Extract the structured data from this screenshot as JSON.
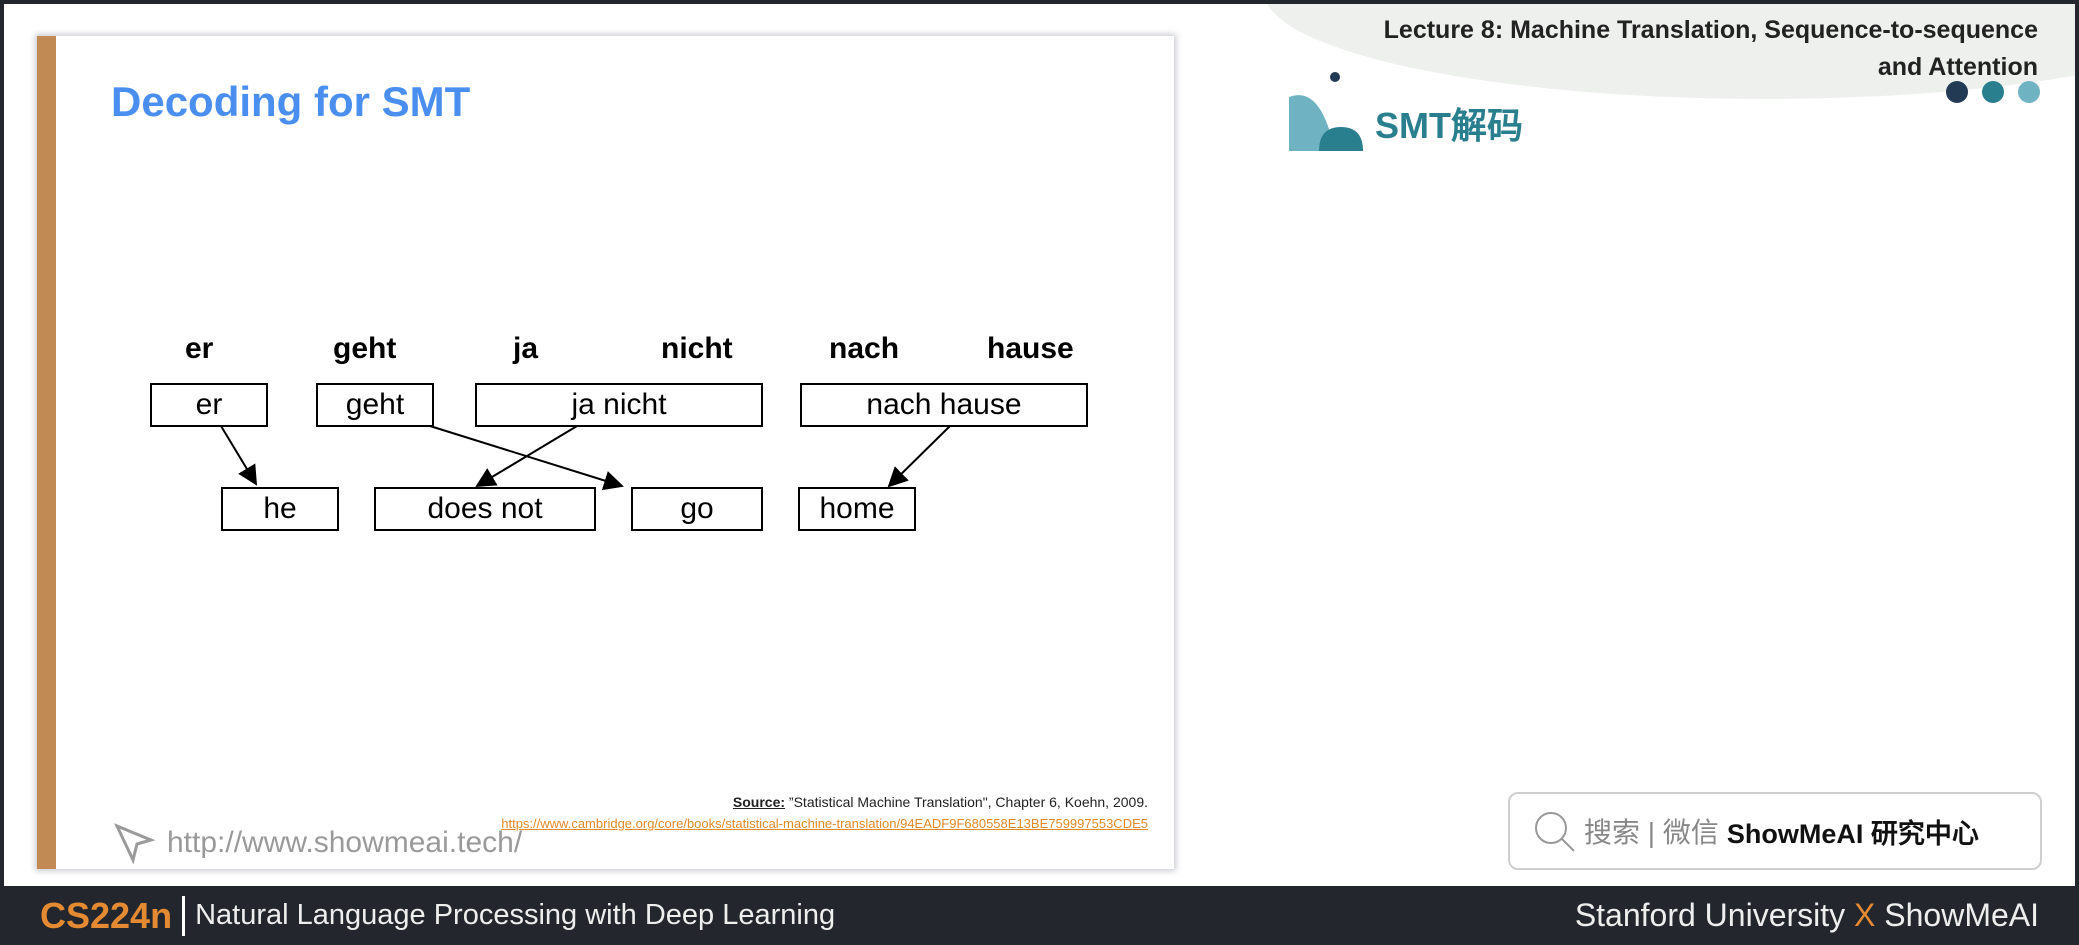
{
  "header": {
    "lecture_line1": "Lecture 8:  Machine Translation, Sequence-to-sequence",
    "lecture_line2": "and Attention",
    "section_title": "SMT解码"
  },
  "slide": {
    "title": "Decoding for SMT",
    "source_words": [
      "er",
      "geht",
      "ja",
      "nicht",
      "nach",
      "hause"
    ],
    "phrases": [
      "er",
      "geht",
      "ja nicht",
      "nach hause"
    ],
    "translations": [
      "he",
      "does not",
      "go",
      "home"
    ],
    "source_label": "Source:",
    "source_text": " ”Statistical Machine Translation\", Chapter 6, Koehn, 2009.",
    "source_link": "https://www.cambridge.org/core/books/statistical-machine-translation/94EADF9F680558E13BE759997553CDE5",
    "watermark": "http://www.showmeai.tech/"
  },
  "search": {
    "text": "搜索 | 微信",
    "brand": "ShowMeAI 研究中心"
  },
  "footer": {
    "course_code": "CS224n",
    "course_name": "Natural Language Processing with Deep Learning",
    "university": "Stanford University",
    "x": "X",
    "partner": "ShowMeAI"
  },
  "colors": {
    "accent_orange": "#e48a32",
    "title_blue": "#4a8ff0",
    "teal": "#2a7f8f",
    "footer_bg": "#23272d",
    "slide_bar": "#c18a55"
  }
}
